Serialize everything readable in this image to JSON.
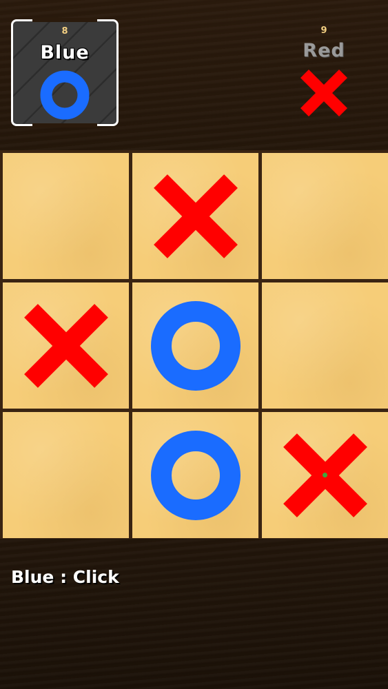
{
  "players": {
    "blue": {
      "score": "8",
      "name": "Blue",
      "mark": "o-icon",
      "active": true
    },
    "red": {
      "score": "9",
      "name": "Red",
      "mark": "x-icon",
      "active": false
    }
  },
  "board": [
    [
      "",
      "X",
      ""
    ],
    [
      "X",
      "O",
      ""
    ],
    [
      "",
      "O",
      "X"
    ]
  ],
  "status": "Blue : Click",
  "colors": {
    "x": "#ff0000",
    "o": "#1a6cff",
    "cell": "#f6cd78",
    "board_lines": "#3a2412",
    "background": "#24170b"
  }
}
